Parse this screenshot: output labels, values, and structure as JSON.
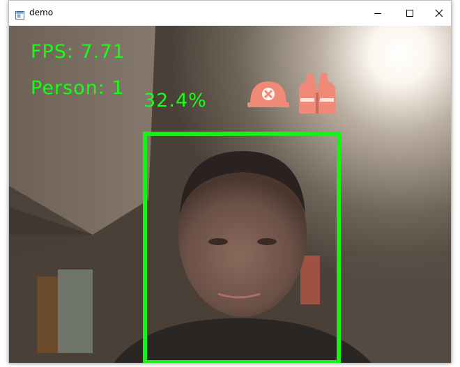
{
  "window": {
    "title": "demo",
    "icons": {
      "app": "window-app-icon",
      "minimize": "minimize-icon",
      "maximize": "maximize-icon",
      "close": "close-icon"
    }
  },
  "overlay": {
    "fps": "FPS: 7.71",
    "person": "Person: 1",
    "confidence": "32.4%",
    "text_color": "#14ff14",
    "box_color": "#18f018"
  },
  "ppe": {
    "helmet": {
      "icon": "helmet-missing-icon",
      "color": "#f08a78"
    },
    "vest": {
      "icon": "safety-vest-icon",
      "color": "#f08a78"
    }
  }
}
